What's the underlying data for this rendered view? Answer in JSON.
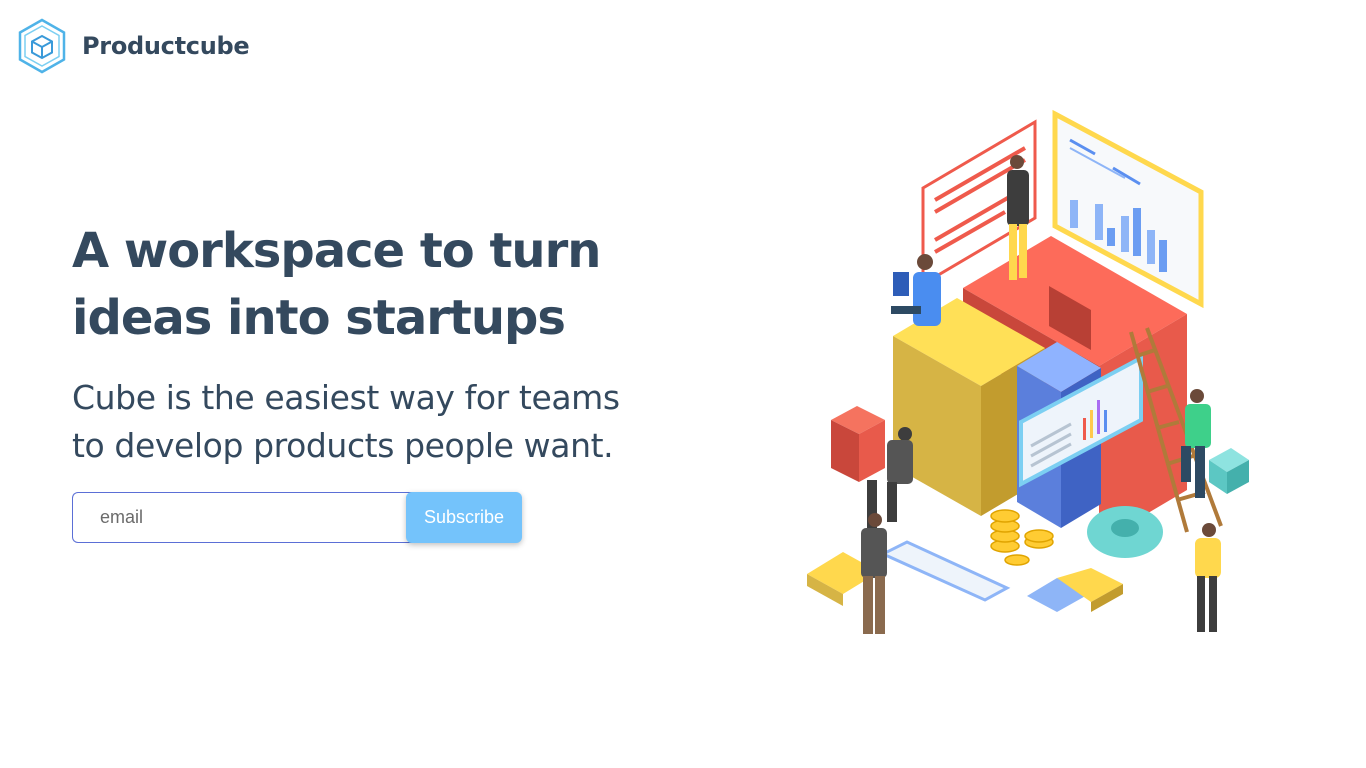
{
  "header": {
    "brand": "Productcube",
    "logo_icon": "hexagon-cube-icon"
  },
  "hero": {
    "headline_line1": "A workspace to turn",
    "headline_line2": "ideas into startups",
    "subhead_line1": "Cube is the easiest way for teams",
    "subhead_line2": "to develop products people want."
  },
  "signup": {
    "email_placeholder": "email",
    "email_value": "",
    "subscribe_label": "Subscribe"
  },
  "colors": {
    "text": "#34495e",
    "accent": "#74c3fb",
    "input_border": "#5b6fd6"
  },
  "illustration": {
    "icon": "isometric-startup-team-illustration"
  }
}
